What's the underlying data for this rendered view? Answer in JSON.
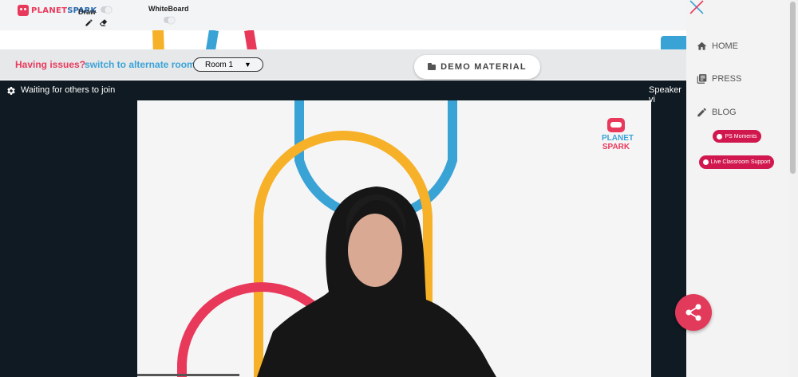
{
  "header": {
    "logo_word1": "PLANET",
    "logo_word2": "SPARK",
    "draw_label": "Draw",
    "whiteboard_label": "WhiteBoard",
    "tools": [
      "pencil-icon",
      "eraser-icon"
    ]
  },
  "issues": {
    "prefix": "Having issues?",
    "link": "switch to alternate room",
    "room_selected": "Room 1"
  },
  "demo_material": {
    "label": "DEMO MATERIAL",
    "icon": "folder-icon"
  },
  "video": {
    "status": "Waiting for others to join",
    "view_label": "Speaker vi",
    "brand_line1": "PLANET",
    "brand_line2": "SPARK"
  },
  "sidebar": {
    "nav": [
      {
        "label": "HOME",
        "icon": "home-icon"
      },
      {
        "label": "PRESS",
        "icon": "newspaper-icon"
      },
      {
        "label": "BLOG",
        "icon": "pencil-icon"
      }
    ],
    "pills": [
      "PS Moments",
      "Live Classroom Support"
    ]
  },
  "colors": {
    "brand_red": "#e8395b",
    "brand_blue": "#3aa3d6",
    "yellow": "#f6b128",
    "pill_red": "#d1184e",
    "video_bg": "#0f1a22"
  }
}
